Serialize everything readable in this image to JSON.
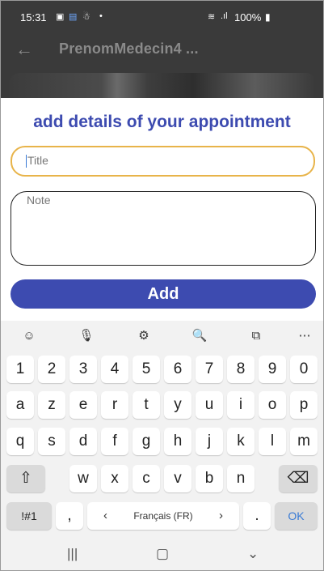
{
  "status": {
    "time": "15:31",
    "icons": [
      "image-icon",
      "app-icon",
      "person-icon",
      "dot-icon"
    ],
    "signal_text": "100%"
  },
  "appbar": {
    "title": "PrenomMedecin4 ..."
  },
  "form": {
    "heading": "add details of your appointment",
    "title_placeholder": "Title",
    "note_placeholder": "Note",
    "add_label": "Add"
  },
  "keyboard": {
    "tools": [
      "emoji-icon",
      "mic-icon",
      "settings-icon",
      "search-icon",
      "translate-icon",
      "more-icon"
    ],
    "row_numbers": [
      "1",
      "2",
      "3",
      "4",
      "5",
      "6",
      "7",
      "8",
      "9",
      "0"
    ],
    "row1": [
      "a",
      "z",
      "e",
      "r",
      "t",
      "y",
      "u",
      "i",
      "o",
      "p"
    ],
    "row2": [
      "q",
      "s",
      "d",
      "f",
      "g",
      "h",
      "j",
      "k",
      "l",
      "m"
    ],
    "row3": [
      "w",
      "x",
      "c",
      "v",
      "b",
      "n"
    ],
    "symbols_label": "!#1",
    "comma_label": ",",
    "space_label": "Français (FR)",
    "space_left": "‹",
    "space_right": "›",
    "period_label": ".",
    "ok_label": "OK"
  },
  "colors": {
    "accent": "#3d4bb0",
    "focus": "#e8b44a"
  }
}
